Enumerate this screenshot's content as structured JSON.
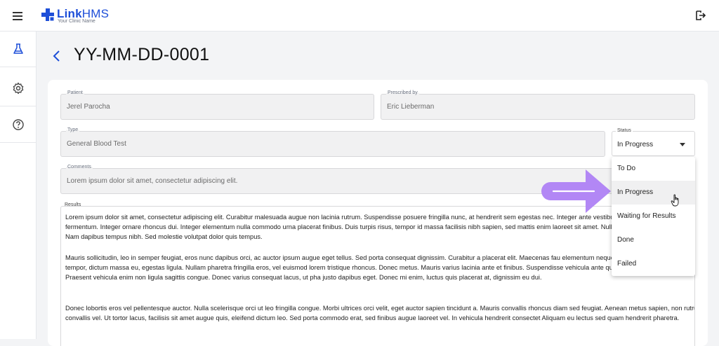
{
  "app": {
    "name_bold": "Link",
    "name_light": "HMS",
    "subtitle": "Your Clinic Name",
    "brand_color": "#1d4ed8"
  },
  "sidebar": {
    "items": [
      {
        "icon": "flask-icon",
        "active": true
      },
      {
        "icon": "gear-icon",
        "active": false
      },
      {
        "icon": "help-circle-icon",
        "active": false
      }
    ]
  },
  "page": {
    "title": "YY-MM-DD-0001"
  },
  "form": {
    "patient": {
      "label": "Patient",
      "value": "Jerel Parocha"
    },
    "prescribed_by": {
      "label": "Prescribed by",
      "value": "Eric Lieberman"
    },
    "type": {
      "label": "Type",
      "value": "General Blood Test"
    },
    "status": {
      "label": "Status",
      "value": "In Progress"
    },
    "comments": {
      "label": "Comments",
      "value": "Lorem ipsum dolor sit amet, consectetur adipiscing elit."
    },
    "results": {
      "label": "Results",
      "paragraphs": [
        "Lorem ipsum dolor sit amet, consectetur adipiscing elit. Curabitur malesuada augue non lacinia rutrum. Suspendisse posuere fringilla nunc, at hendrerit sem egestas nec. Integer ante vestibulum mattis. Nulla ornare mattis fermentum. Integer ornare rhoncus dui. Integer elementum nulla commodo urna placerat finibus. Duis turpis risus, tempor id massa facilisis nibh sapien, sed mattis enim laoreet sit amet. Nulla facilisi. Praesent vel pretium enim. Nam dapibus tempus nibh. Sed molestie volutpat dolor quis tempus.",
        "Mauris sollicitudin, leo in semper feugiat, eros nunc dapibus orci, ac auctor ipsum augue eget tellus. Sed porta consequat dignissim. Curabitur a placerat elit. Maecenas fau elementum neque, sed facilisis dolor. Curabitur in orci tempor, dictum massa eu, egestas ligula. Nullam pharetra fringilla eros, vel euismod lorem tristique rhoncus. Donec metus. Mauris varius lacinia ante et finibus. Suspendisse vehicula ante quam, ac ornare ipsum suscipit sed. Praesent vehicula enim non ligula sagittis congue. Donec varius consequat lacus, ut pha justo dapibus eget. Donec mi enim, luctus quis placerat at, dignissim eu dui.",
        "Donec lobortis eros vel pellentesque auctor. Nulla scelerisque orci ut leo fringilla congue. Morbi ultrices orci velit, eget auctor sapien tincidunt a. Mauris convallis rhoncus diam sed feugiat. Aenean metus sapien, non rutrum ante convallis vel. Ut tortor lacus, facilisis sit amet augue quis, eleifend dictum leo. Sed porta commodo erat, sed finibus augue laoreet vel. In vehicula hendrerit consectet Aliquam eu lectus sed quam hendrerit pharetra."
      ]
    }
  },
  "status_dropdown": {
    "options": [
      "To Do",
      "In Progress",
      "Waiting for Results",
      "Done",
      "Failed"
    ],
    "highlighted": "In Progress"
  },
  "annotation": {
    "arrow_color": "#b287f5"
  }
}
